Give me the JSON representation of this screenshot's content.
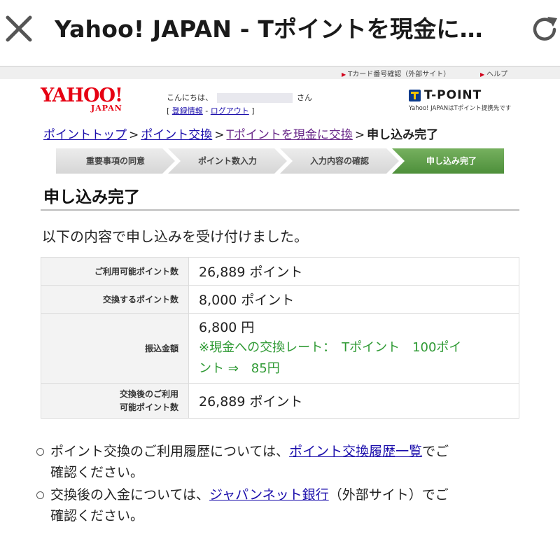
{
  "browser": {
    "title": "Yahoo! JAPAN - Tポイントを現金に…"
  },
  "utility_links": [
    {
      "label": "Tカード番号確認（外部サイト）"
    },
    {
      "label": "ヘルプ"
    }
  ],
  "header": {
    "logo_main": "YAHOO!",
    "logo_sub": "JAPAN",
    "greeting_prefix": "こんにちは、",
    "greeting_suffix": "さん",
    "register_label": "登録情報",
    "logout_label": "ログアウト",
    "tpoint_name": "T-POINT",
    "tpoint_note": "Yahoo! JAPANはTポイント提携先です"
  },
  "breadcrumb": {
    "items": [
      "ポイントトップ",
      "ポイント交換",
      "Tポイントを現金に交換"
    ],
    "current": "申し込み完了",
    "separator": ">"
  },
  "steps": [
    {
      "label": "重要事項の同意",
      "active": false
    },
    {
      "label": "ポイント数入力",
      "active": false
    },
    {
      "label": "入力内容の確認",
      "active": false
    },
    {
      "label": "申し込み完了",
      "active": true
    }
  ],
  "main": {
    "heading": "申し込み完了",
    "lead": "以下の内容で申し込みを受け付けました。",
    "rows": [
      {
        "label": "ご利用可能ポイント数",
        "value": "26,889 ポイント"
      },
      {
        "label": "交換するポイント数",
        "value": "8,000 ポイント"
      },
      {
        "label": "振込金額",
        "value": "6,800 円",
        "rate_line1": "※現金への交換レート：　Tポイント　100ポイ",
        "rate_line2": "ント ⇒　85円"
      },
      {
        "label_line1": "交換後のご利用",
        "label_line2": "可能ポイント数",
        "value": "26,889 ポイント"
      }
    ]
  },
  "notes": [
    {
      "before": "ポイント交換のご利用履歴については、",
      "link": "ポイント交換履歴一覧",
      "after": "でご",
      "line2": "確認ください。"
    },
    {
      "before": "交換後の入金については、",
      "link": "ジャパンネット銀行",
      "after": "（外部サイト）でご",
      "line2": "確認ください。"
    }
  ]
}
